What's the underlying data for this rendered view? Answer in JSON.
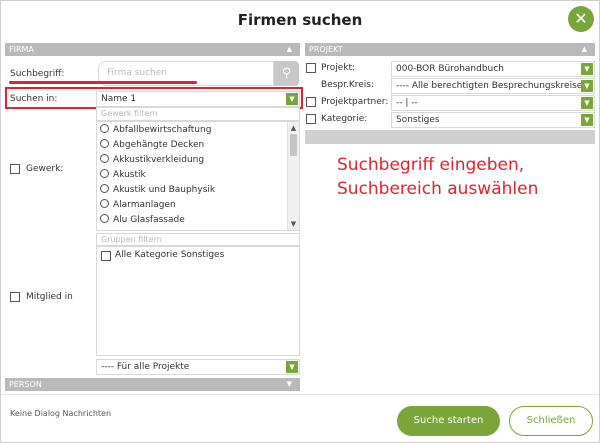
{
  "dialog": {
    "title": "Firmen suchen",
    "close_icon": "close-x-icon",
    "accent_color": "#7aa53a",
    "highlight_color": "#e0232f"
  },
  "firma": {
    "section_label": "FIRMA",
    "suchbegriff_label": "Suchbegriff:",
    "search_placeholder": "Firma suchen",
    "search_value": "",
    "suchen_in_label": "Suchen in:",
    "suchen_in_value": "Name 1",
    "gewerk_label": "Gewerk:",
    "gewerk_filter_placeholder": "Gewerk filtern",
    "gewerk_items": [
      "Abfallbewirtschaftung",
      "Abgehängte Decken",
      "Akkustikverkleidung",
      "Akustik",
      "Akustik und Bauphysik",
      "Alarmanlagen",
      "Alu Glasfassade"
    ],
    "mitglied_label": "Mitglied in",
    "gruppen_filter_placeholder": "Gruppen filtern",
    "gruppen_items": [
      "Alle Kategorie Sonstiges"
    ],
    "projekte_select_value": "---- Für alle Projekte"
  },
  "person": {
    "section_label": "PERSON"
  },
  "projekt": {
    "section_label": "PROJEKT",
    "projekt_label": "Projekt:",
    "projekt_value": "000-BOR Bürohandbuch",
    "bespr_label": "Bespr.Kreis:",
    "bespr_value": "---- Alle berechtigten Besprechungskreise",
    "partner_label": "Projektpartner:",
    "partner_value": "-- | --",
    "kategorie_label": "Kategorie:",
    "kategorie_value": "Sonstiges"
  },
  "annotation": {
    "line1": "Suchbegriff eingeben,",
    "line2": "Suchbereich auswählen"
  },
  "footer": {
    "message": "Keine Dialog Nachrichten",
    "start_label": "Suche starten",
    "close_label": "Schließen"
  }
}
